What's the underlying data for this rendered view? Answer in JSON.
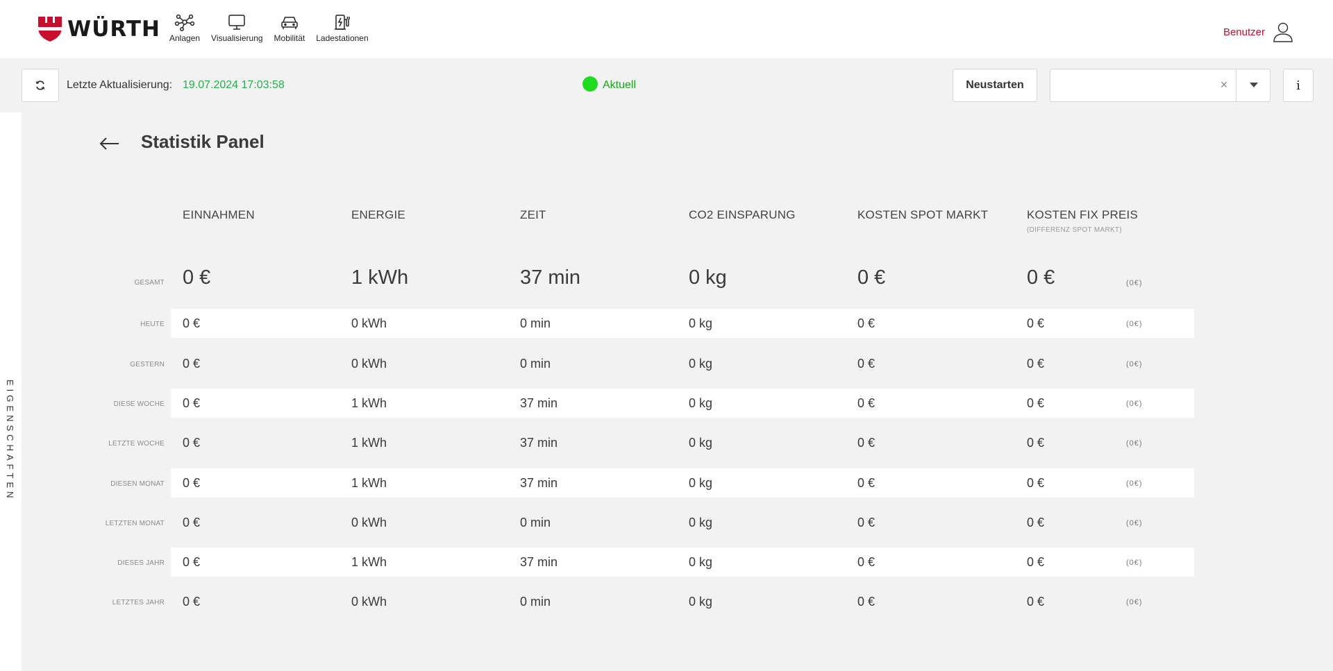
{
  "brand": {
    "name": "WÜRTH",
    "color": "#c8102e"
  },
  "nav": {
    "items": [
      {
        "label": "Anlagen",
        "icon": "network-icon"
      },
      {
        "label": "Visualisierung",
        "icon": "monitor-icon"
      },
      {
        "label": "Mobilität",
        "icon": "car-icon"
      },
      {
        "label": "Ladestationen",
        "icon": "charging-station-icon"
      }
    ],
    "user_label": "Benutzer"
  },
  "status": {
    "last_update_label": "Letzte Aktualisierung:",
    "last_update_value": "19.07.2024 17:03:58",
    "state": "Aktuell",
    "state_color": "#1edb1e",
    "restart_label": "Neustarten",
    "select_value": "",
    "select_clear": "×",
    "info_label": "i"
  },
  "sidetab": {
    "label": "EIGENSCHAFTEN"
  },
  "panel": {
    "title": "Statistik Panel",
    "columns": [
      {
        "label": "EINNAHMEN"
      },
      {
        "label": "ENERGIE"
      },
      {
        "label": "ZEIT"
      },
      {
        "label": "CO2 EINSPARUNG"
      },
      {
        "label": "KOSTEN SPOT MARKT"
      },
      {
        "label": "KOSTEN FIX PREIS",
        "sub": "(DIFFERENZ SPOT MARKT)"
      }
    ],
    "rows": [
      {
        "label": "GESAMT",
        "values": [
          "0 €",
          "1 kWh",
          "37 min",
          "0 kg",
          "0 €",
          "0 €"
        ],
        "diff": "(0€)"
      },
      {
        "label": "HEUTE",
        "values": [
          "0 €",
          "0 kWh",
          "0 min",
          "0 kg",
          "0 €",
          "0 €"
        ],
        "diff": "(0€)"
      },
      {
        "label": "GESTERN",
        "values": [
          "0 €",
          "0 kWh",
          "0 min",
          "0 kg",
          "0 €",
          "0 €"
        ],
        "diff": "(0€)"
      },
      {
        "label": "DIESE WOCHE",
        "values": [
          "0 €",
          "1 kWh",
          "37 min",
          "0 kg",
          "0 €",
          "0 €"
        ],
        "diff": "(0€)"
      },
      {
        "label": "LETZTE WOCHE",
        "values": [
          "0 €",
          "1 kWh",
          "37 min",
          "0 kg",
          "0 €",
          "0 €"
        ],
        "diff": "(0€)"
      },
      {
        "label": "DIESEN MONAT",
        "values": [
          "0 €",
          "1 kWh",
          "37 min",
          "0 kg",
          "0 €",
          "0 €"
        ],
        "diff": "(0€)"
      },
      {
        "label": "LETZTEN MONAT",
        "values": [
          "0 €",
          "0 kWh",
          "0 min",
          "0 kg",
          "0 €",
          "0 €"
        ],
        "diff": "(0€)"
      },
      {
        "label": "DIESES JAHR",
        "values": [
          "0 €",
          "1 kWh",
          "37 min",
          "0 kg",
          "0 €",
          "0 €"
        ],
        "diff": "(0€)"
      },
      {
        "label": "LETZTES JAHR",
        "values": [
          "0 €",
          "0 kWh",
          "0 min",
          "0 kg",
          "0 €",
          "0 €"
        ],
        "diff": "(0€)"
      }
    ]
  }
}
